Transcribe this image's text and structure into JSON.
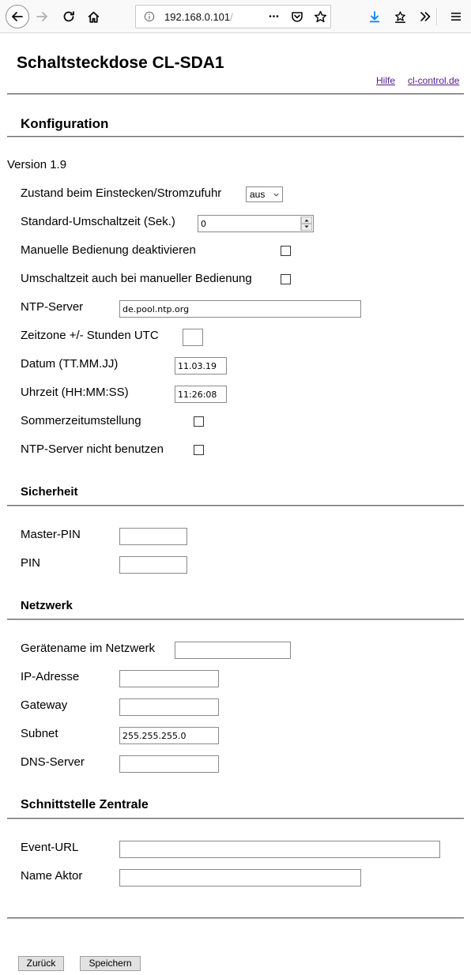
{
  "browser": {
    "url_host": "192.168.0.101",
    "url_rest": "/",
    "menu_dots": "•••"
  },
  "header": {
    "title": "Schaltsteckdose CL-SDA1",
    "links": [
      "Hilfe",
      "cl-control.de"
    ]
  },
  "konfiguration": {
    "heading": "Konfiguration",
    "version": "Version 1.9",
    "zustand_label": "Zustand beim Einstecken/Stromzufuhr",
    "zustand_value": "aus",
    "umschaltzeit_label": "Standard-Umschaltzeit (Sek.)",
    "umschaltzeit_value": "0",
    "manuell_deaktivieren_label": "Manuelle Bedienung deaktivieren",
    "umschalt_manuell_label": "Umschaltzeit auch bei manueller Bedienung",
    "ntp_label": "NTP-Server",
    "ntp_value": "de.pool.ntp.org",
    "zeitzone_label": "Zeitzone +/- Stunden UTC",
    "zeitzone_value": "",
    "datum_label": "Datum (TT.MM.JJ)",
    "datum_value": "11.03.19",
    "uhrzeit_label": "Uhrzeit (HH:MM:SS)",
    "uhrzeit_value": "11:26:08",
    "sommerzeit_label": "Sommerzeitumstellung",
    "ntp_nicht_label": "NTP-Server nicht benutzen"
  },
  "sicherheit": {
    "heading": "Sicherheit",
    "master_pin_label": "Master-PIN",
    "master_pin_value": "",
    "pin_label": "PIN",
    "pin_value": ""
  },
  "netzwerk": {
    "heading": "Netzwerk",
    "geraetename_label": "Gerätename im Netzwerk",
    "geraetename_value": "",
    "ip_label": "IP-Adresse",
    "ip_value": "",
    "gateway_label": "Gateway",
    "gateway_value": "",
    "subnet_label": "Subnet",
    "subnet_value": "255.255.255.0",
    "dns_label": "DNS-Server",
    "dns_value": ""
  },
  "zentrale": {
    "heading": "Schnittstelle Zentrale",
    "event_url_label": "Event-URL",
    "event_url_value": "",
    "name_aktor_label": "Name Aktor",
    "name_aktor_value": ""
  },
  "buttons": {
    "back": "Zurück",
    "save": "Speichern"
  }
}
